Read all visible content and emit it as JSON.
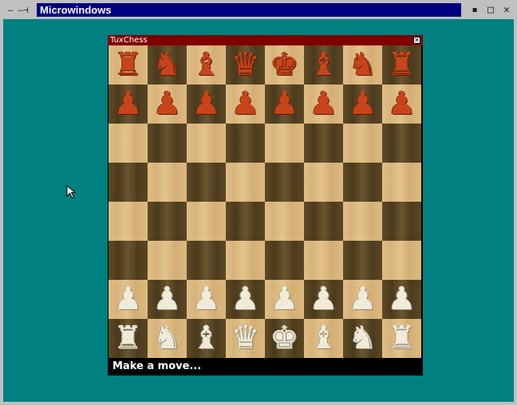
{
  "window": {
    "title": "Microwindows",
    "left_buttons": [
      "—",
      "—⊣"
    ],
    "right_buttons": [
      "▪",
      "□",
      "✕"
    ]
  },
  "colors": {
    "desktop": "#008080",
    "titlebar_active": "#000080",
    "child_titlebar": "#800000"
  },
  "app": {
    "title": "TuxChess",
    "close_glyph": "✕",
    "status": "Make a move..."
  },
  "board": {
    "rows": [
      [
        "♜",
        "♞",
        "♝",
        "♛",
        "♚",
        "♝",
        "♞",
        "♜"
      ],
      [
        "♟",
        "♟",
        "♟",
        "♟",
        "♟",
        "♟",
        "♟",
        "♟"
      ],
      [
        "",
        "",
        "",
        "",
        "",
        "",
        "",
        ""
      ],
      [
        "",
        "",
        "",
        "",
        "",
        "",
        "",
        ""
      ],
      [
        "",
        "",
        "",
        "",
        "",
        "",
        "",
        ""
      ],
      [
        "",
        "",
        "",
        "",
        "",
        "",
        "",
        ""
      ],
      [
        "♟",
        "♟",
        "♟",
        "♟",
        "♟",
        "♟",
        "♟",
        "♟"
      ],
      [
        "♜",
        "♞",
        "♝",
        "♛",
        "♚",
        "♝",
        "♞",
        "♜"
      ]
    ],
    "side": [
      "black",
      "black",
      "",
      "",
      "",
      "",
      "white",
      "white"
    ]
  }
}
